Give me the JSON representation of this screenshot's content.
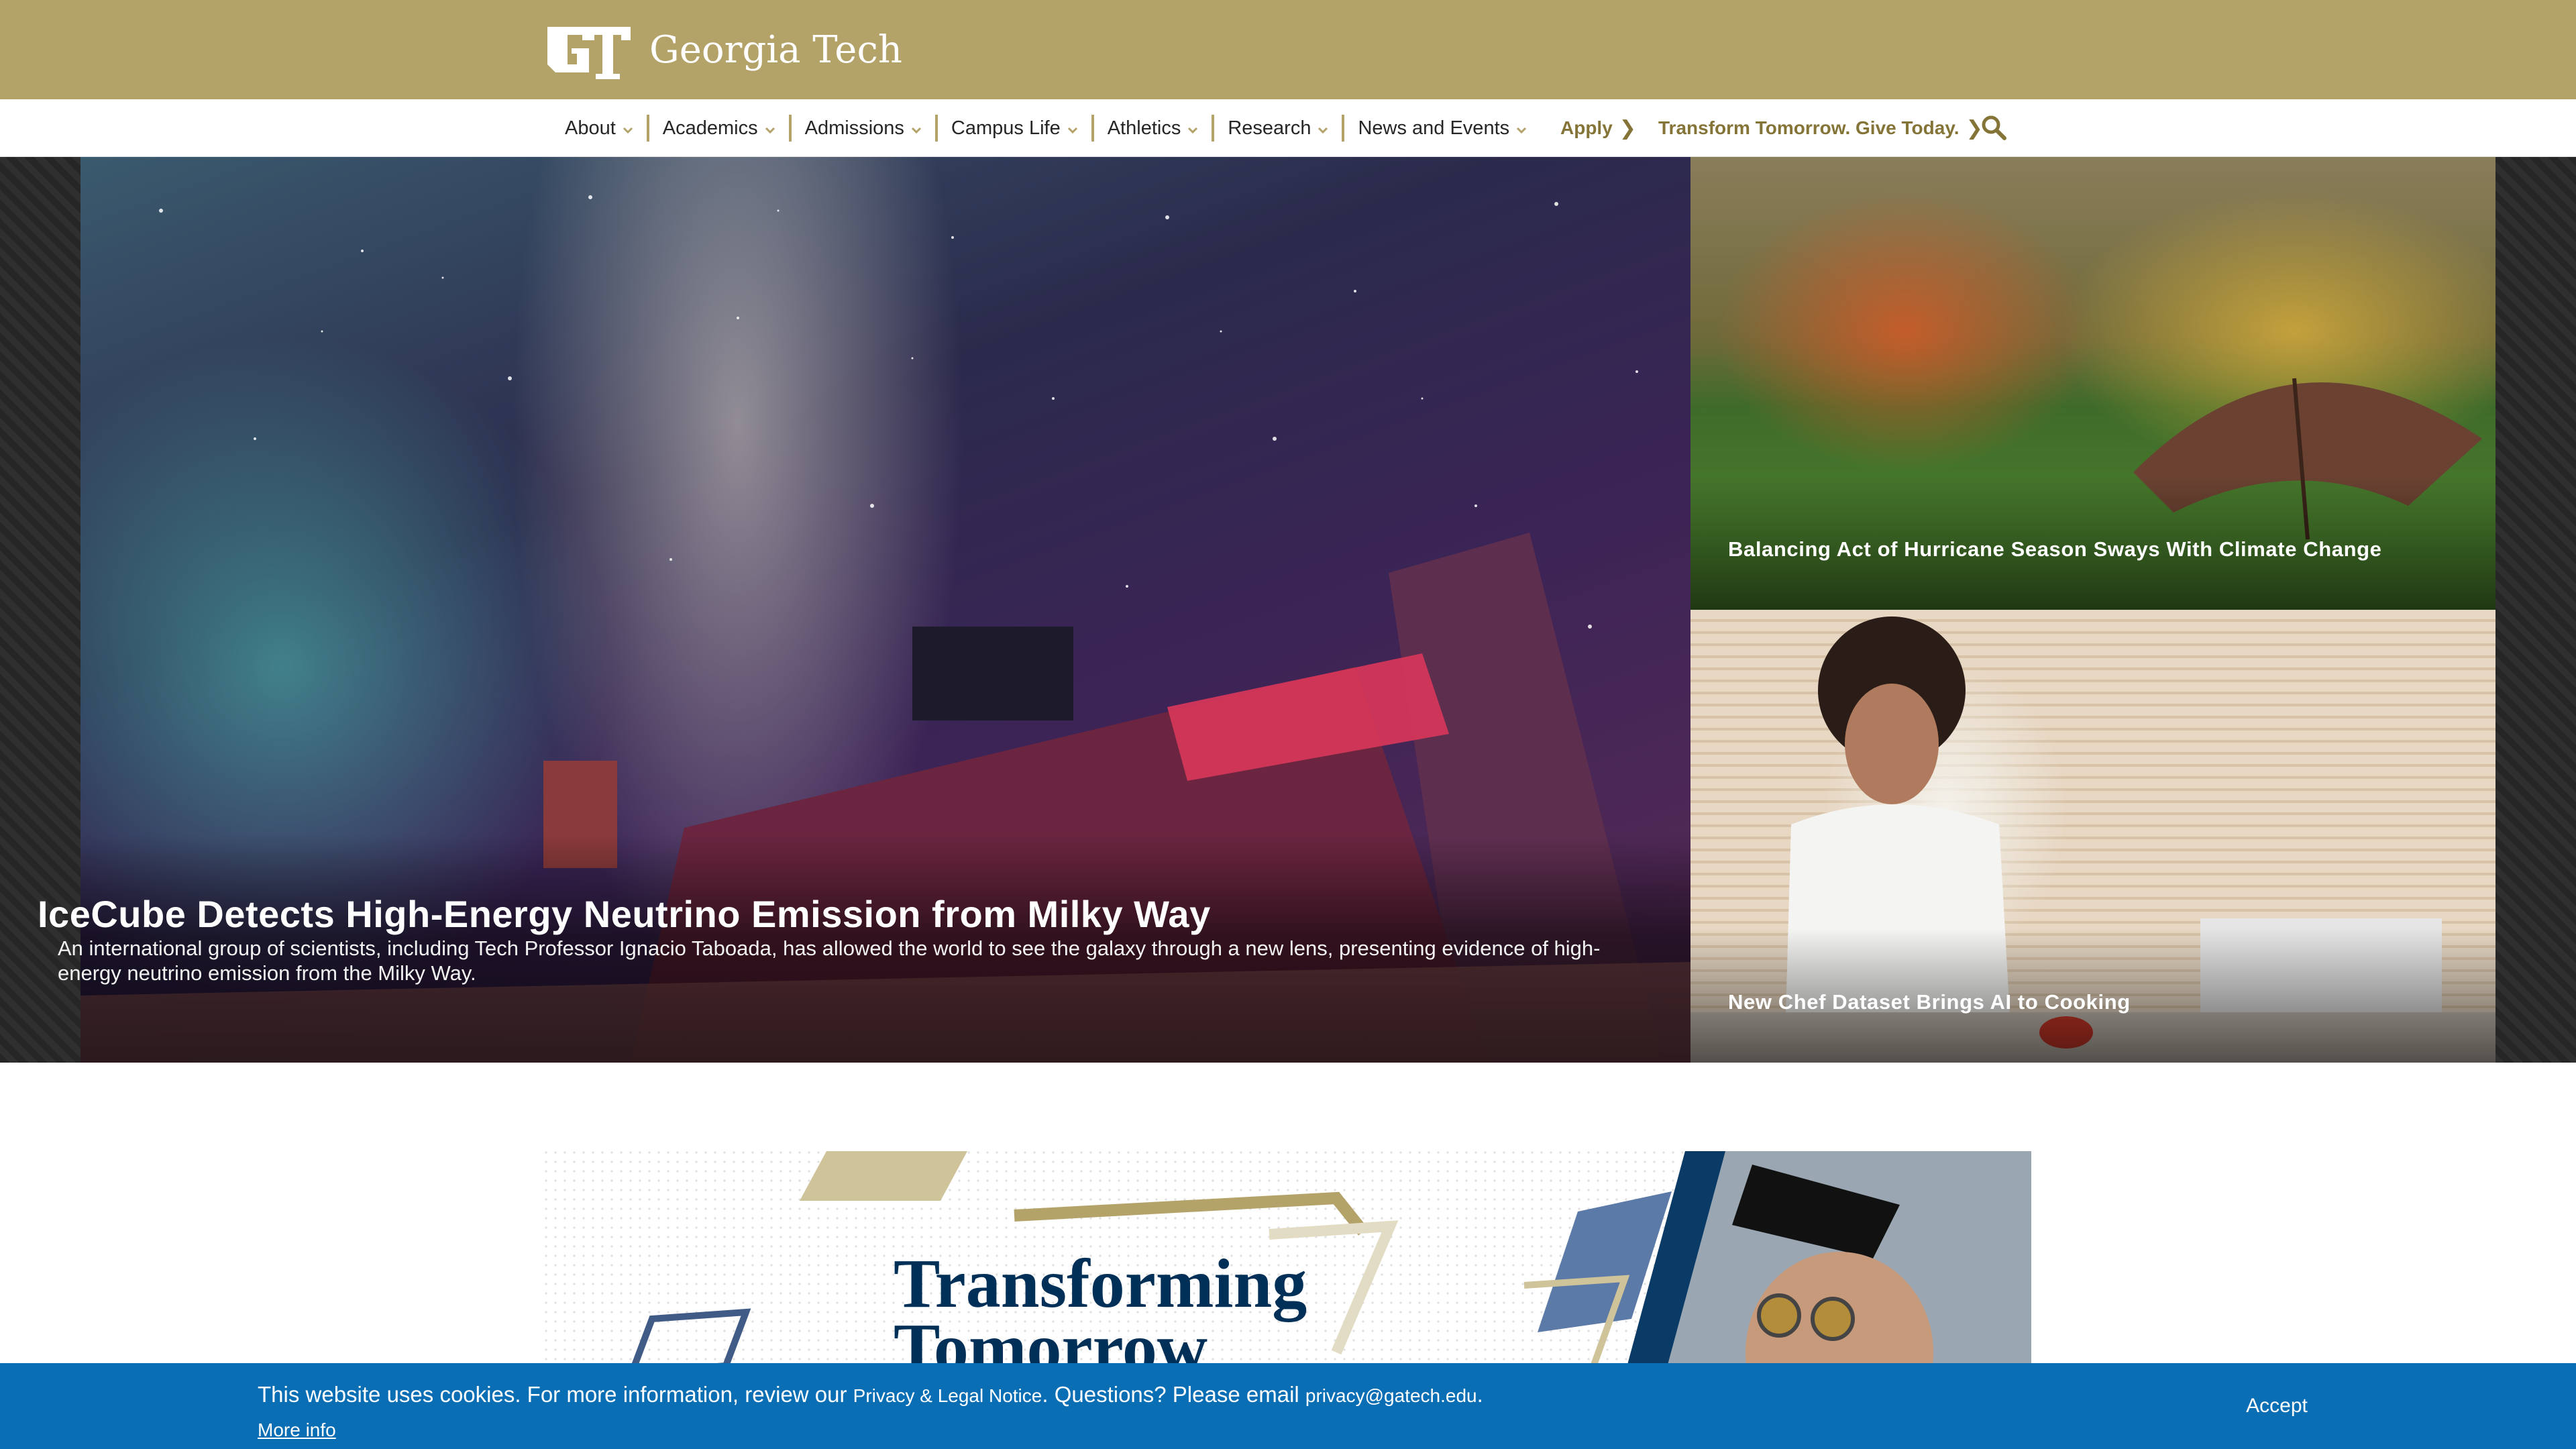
{
  "header": {
    "logo_text": "Georgia Tech",
    "logo_mark": "GT"
  },
  "nav": {
    "items": [
      {
        "label": "About"
      },
      {
        "label": "Academics"
      },
      {
        "label": "Admissions"
      },
      {
        "label": "Campus Life"
      },
      {
        "label": "Athletics"
      },
      {
        "label": "Research"
      },
      {
        "label": "News and Events"
      }
    ],
    "apply_label": "Apply",
    "give_label": "Transform Tomorrow. Give Today.",
    "search_icon": "search-icon"
  },
  "hero": {
    "title": "IceCube Detects High-Energy Neutrino Emission from Milky Way",
    "description": "An international group of scientists, including Tech Professor Ignacio Taboada, has allowed the world to see the galaxy through a new lens, presenting evidence of high-energy neutrino emission from the Milky Way."
  },
  "cards": [
    {
      "title": "Balancing Act of Hurricane Season Sways With Climate Change"
    },
    {
      "title": "New Chef Dataset Brings AI to Cooking"
    }
  ],
  "promo": {
    "title_line1": "Transforming",
    "title_line2": "Tomorrow"
  },
  "cookie": {
    "text_before": "This website uses cookies. For more information, review our ",
    "privacy_link": "Privacy & Legal Notice",
    "text_middle": ". Questions? Please email ",
    "email_link": "privacy@gatech.edu",
    "text_end": ".",
    "more_info": "More info",
    "accept": "Accept"
  },
  "colors": {
    "gold": "#b3a369",
    "dark_gold": "#857437",
    "navy": "#003057",
    "cookie_blue": "#0a6eb5"
  }
}
